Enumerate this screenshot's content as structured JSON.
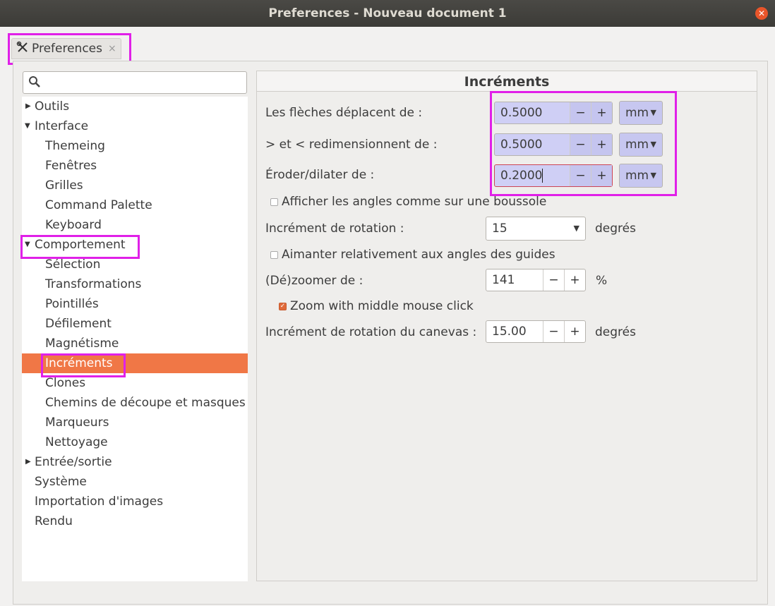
{
  "window": {
    "title": "Preferences - Nouveau document 1"
  },
  "tab": {
    "label": "Preferences",
    "close": "×"
  },
  "search": {
    "value": ""
  },
  "tree": {
    "items": [
      "Outils",
      "Interface",
      "Themeing",
      "Fenêtres",
      "Grilles",
      "Command Palette",
      "Keyboard",
      "Comportement",
      "Sélection",
      "Transformations",
      "Pointillés",
      "Défilement",
      "Magnétisme",
      "Incréments",
      "Clones",
      "Chemins de découpe et masques",
      "Marqueurs",
      "Nettoyage",
      "Entrée/sortie",
      "Système",
      "Importation d'images",
      "Rendu"
    ]
  },
  "panel": {
    "title": "Incréments",
    "arrows_label": "Les flèches déplacent de :",
    "arrows_value": "0.5000",
    "resize_label": "> et < redimensionnent de :",
    "resize_value": "0.5000",
    "erode_label": "Éroder/dilater de :",
    "erode_value": "0.2000",
    "unit": "mm",
    "minus": "−",
    "plus": "+",
    "compass_label": "Afficher les angles comme sur une boussole",
    "rotation_label": "Incrément de rotation :",
    "rotation_value": "15",
    "rotation_unit": "degrés",
    "snap_guides_label": "Aimanter relativement aux angles des guides",
    "zoom_label": "(Dé)zoomer de :",
    "zoom_value": "141",
    "zoom_unit": "%",
    "middle_click_label": "Zoom with middle mouse click",
    "canvas_rot_label": "Incrément de rotation du canevas :",
    "canvas_rot_value": "15.00",
    "canvas_rot_unit": "degrés"
  },
  "colors": {
    "accent": "#f07746",
    "highlight": "#e020e8"
  }
}
